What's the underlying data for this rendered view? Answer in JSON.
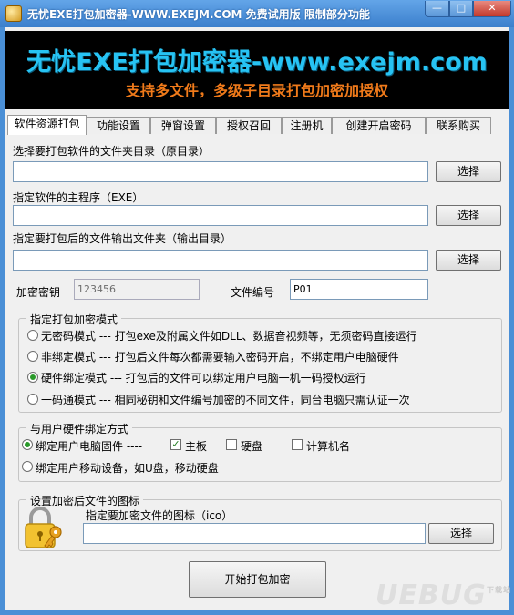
{
  "window": {
    "title": "无忧EXE打包加密器-WWW.EXEJM.COM   免费试用版   限制部分功能",
    "min": "—",
    "max": "□",
    "close": "✕"
  },
  "banner": {
    "title": "无忧EXE打包加密器-www.exejm.com",
    "subtitle": "支持多文件，多级子目录打包加密加授权"
  },
  "tabs": [
    "软件资源打包",
    "功能设置",
    "弹窗设置",
    "授权召回",
    "注册机",
    "创建开启密码",
    "联系购买"
  ],
  "form": {
    "source_label": "选择要打包软件的文件夹目录（原目录）",
    "source_value": "",
    "main_label": "指定软件的主程序（EXE）",
    "main_value": "",
    "output_label": "指定要打包后的文件输出文件夹（输出目录）",
    "output_value": "",
    "browse": "选择",
    "key_label": "加密密钥",
    "key_value": "123456",
    "file_no_label": "文件编号",
    "file_no_value": "P01"
  },
  "mode_group": {
    "title": "指定打包加密模式",
    "options": [
      {
        "label": "无密码模式 --- 打包exe及附属文件如DLL、数据音视频等，无须密码直接运行",
        "checked": false
      },
      {
        "label": "非绑定模式 --- 打包后文件每次都需要输入密码开启，不绑定用户电脑硬件",
        "checked": false
      },
      {
        "label": "硬件绑定模式 --- 打包后的文件可以绑定用户电脑一机一码授权运行",
        "checked": true
      },
      {
        "label": "一码通模式 --- 相同秘钥和文件编号加密的不同文件，同台电脑只需认证一次",
        "checked": false
      }
    ]
  },
  "bind_group": {
    "title": "与用户硬件绑定方式",
    "pc_label": "绑定用户电脑固件  ----",
    "pc_checked": true,
    "mainboard": "主板",
    "disk": "硬盘",
    "computer_name": "计算机名",
    "mobile_label": "绑定用户移动设备，如U盘，移动硬盘"
  },
  "icon_group": {
    "title": "设置加密后文件的图标",
    "label": "指定要加密文件的图标（ico）",
    "value": "",
    "browse": "选择"
  },
  "start_button": "开始打包加密",
  "watermark": "UEBUG",
  "watermark_small": "下载站",
  "colors": {
    "banner_title": "#27c3f3",
    "banner_sub": "#f07a1a",
    "title_bar": "#3b7fcc"
  }
}
